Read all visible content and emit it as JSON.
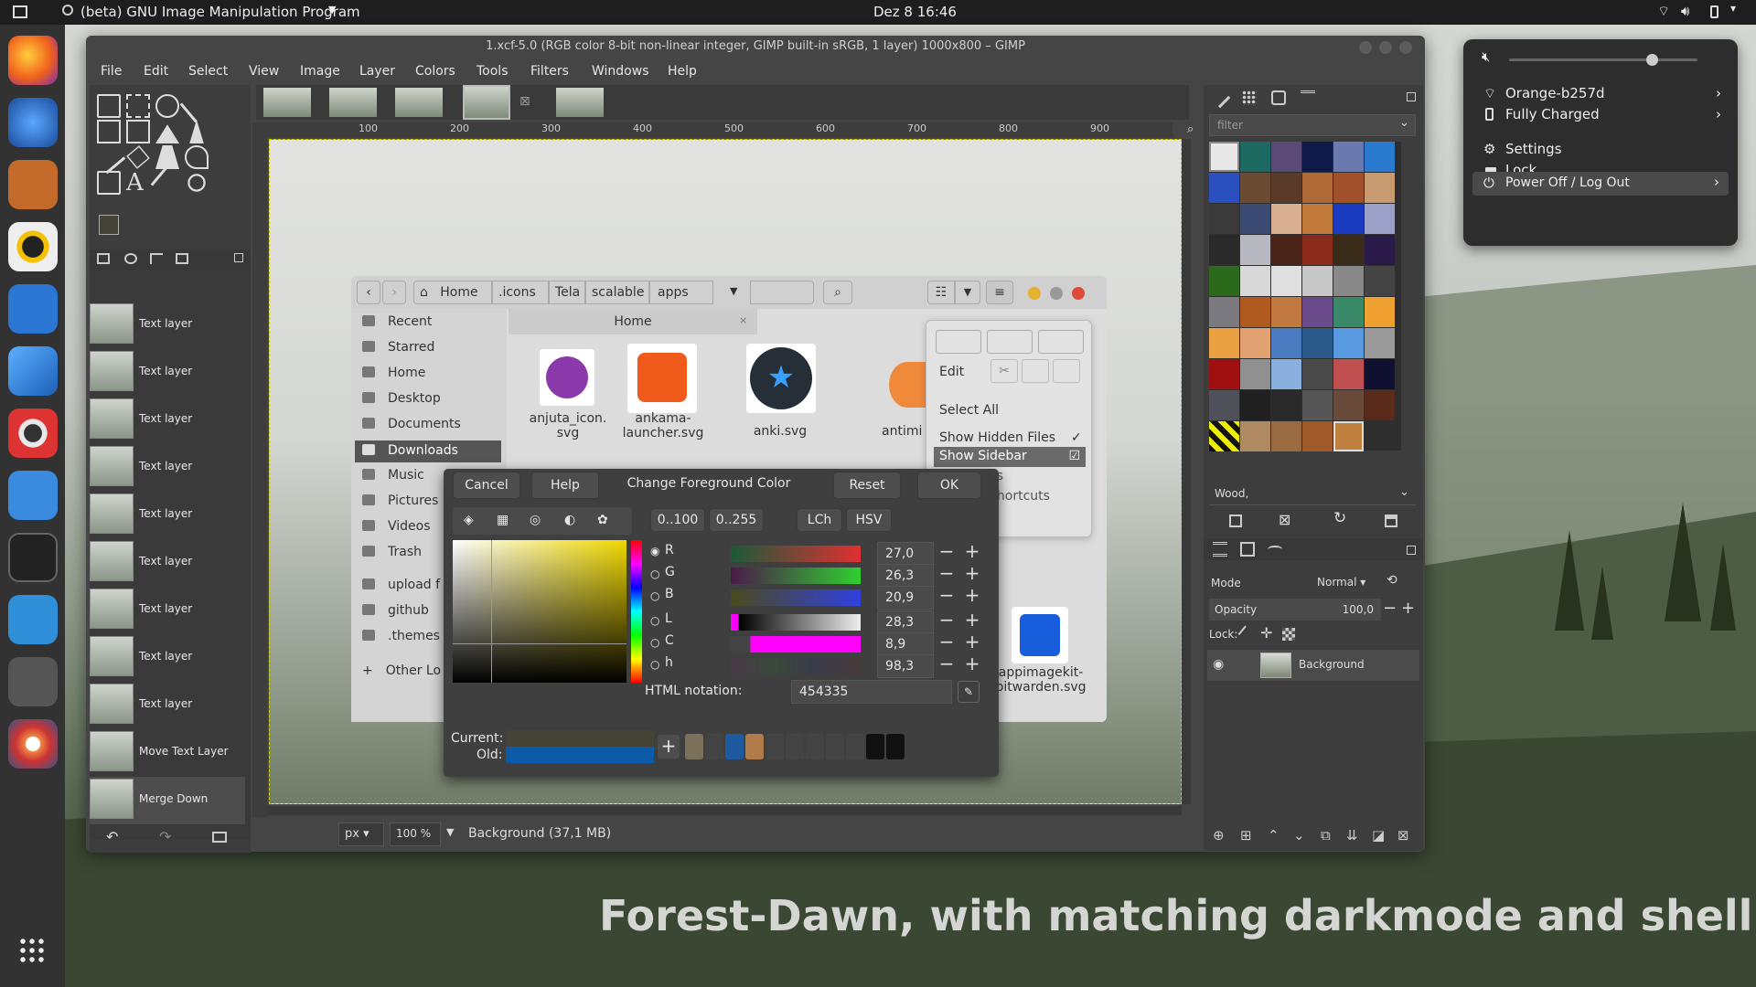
{
  "topbar": {
    "app_name": "(beta) GNU Image Manipulation Program",
    "clock": "Dez 8  16:46"
  },
  "gimp": {
    "title": "1.xcf-5.0 (RGB color 8-bit non-linear integer, GIMP built-in sRGB, 1 layer) 1000x800 – GIMP",
    "menu": [
      "File",
      "Edit",
      "Select",
      "View",
      "Image",
      "Layer",
      "Colors",
      "Tools",
      "Filters",
      "Windows",
      "Help"
    ],
    "ruler_labels": [
      "100",
      "200",
      "300",
      "400",
      "500",
      "600",
      "700",
      "800",
      "900"
    ],
    "layers": [
      "Text layer",
      "Text layer",
      "Text layer",
      "Text layer",
      "Text layer",
      "Text layer",
      "Text layer",
      "Text layer",
      "Text layer",
      "Move Text Layer",
      "Merge Down"
    ],
    "status": {
      "unit": "px",
      "zoom": "100 %",
      "info": "Background (37,1 MB)"
    },
    "right": {
      "filter_placeholder": "filter",
      "pattern_name": "Wood,",
      "mode_label": "Mode",
      "mode_value": "Normal",
      "opacity_label": "Opacity",
      "opacity_value": "100,0",
      "lock_label": "Lock:",
      "layer_name": "Background"
    }
  },
  "filechooser": {
    "path": [
      "Home",
      ".icons",
      "Tela",
      "scalable",
      "apps"
    ],
    "tab": "Home",
    "sidebar": [
      "Recent",
      "Starred",
      "Home",
      "Desktop",
      "Documents",
      "Downloads",
      "Music",
      "Pictures",
      "Videos",
      "Trash",
      "upload f",
      "github",
      ".themes",
      "Other Lo"
    ],
    "files": [
      {
        "name": "anjuta_icon.\nsvg"
      },
      {
        "name": "ankama-\nlauncher.svg"
      },
      {
        "name": "anki.svg"
      },
      {
        "name": "antimi"
      },
      {
        "name": "appimagekit-\nbitwarden.svg"
      }
    ],
    "menu": {
      "edit": "Edit",
      "select_all": "Select All",
      "show_hidden": "Show Hidden Files",
      "show_sidebar": "Show Sidebar",
      "partial1": "es",
      "partial2": "Shortcuts",
      "partial3": "s"
    }
  },
  "colordialog": {
    "title": "Change Foreground Color",
    "cancel": "Cancel",
    "help": "Help",
    "reset": "Reset",
    "ok": "OK",
    "range1": "0..100",
    "range2": "0..255",
    "lch": "LCh",
    "hsv": "HSV",
    "channels": [
      {
        "name": "R",
        "value": "27,0"
      },
      {
        "name": "G",
        "value": "26,3"
      },
      {
        "name": "B",
        "value": "20,9"
      },
      {
        "name": "L",
        "value": "28,3"
      },
      {
        "name": "C",
        "value": "8,9"
      },
      {
        "name": "h",
        "value": "98,3"
      }
    ],
    "html_label": "HTML notation:",
    "html_value": "454335",
    "current_label": "Current:",
    "old_label": "Old:",
    "current_color": "#454335",
    "old_color": "#0b5aa8",
    "history": [
      "#7a7158",
      "#444",
      "#1e5aa0",
      "#b07a4a",
      "#444",
      "#444",
      "#444",
      "#444",
      "#444",
      "#111",
      "#111"
    ]
  },
  "sysmenu": {
    "wifi": "Orange-b257d",
    "battery": "Fully Charged",
    "settings": "Settings",
    "lock": "Lock",
    "power": "Power Off / Log Out"
  },
  "caption": "Forest-Dawn, with matching darkmode and shell"
}
